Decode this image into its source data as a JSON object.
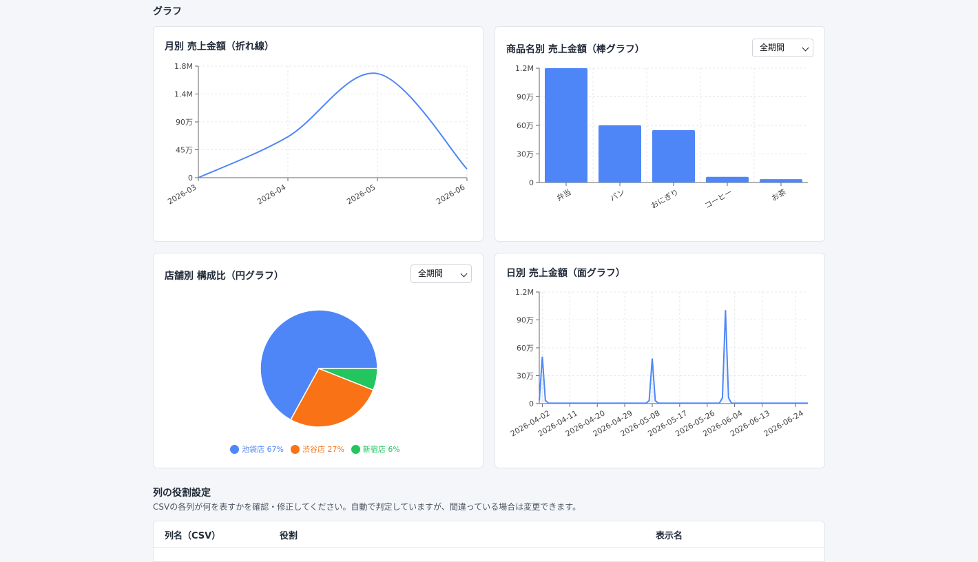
{
  "section_title": "グラフ",
  "charts": {
    "monthly": {
      "title": "月別 売上金額（折れ線）"
    },
    "product": {
      "title": "商品名別 売上金額（棒グラフ）",
      "period_select": "全期間"
    },
    "store": {
      "title": "店舗別 構成比（円グラフ）",
      "period_select": "全期間"
    },
    "daily": {
      "title": "日別 売上金額（面グラフ）"
    }
  },
  "chart_data": [
    {
      "type": "line",
      "title": "月別 売上金額（折れ線）",
      "x": [
        "2026-03",
        "2026-04",
        "2026-05",
        "2026-06"
      ],
      "y": [
        0,
        660000,
        1680000,
        140000
      ],
      "yticks": [
        "0",
        "45万",
        "90万",
        "1.4M",
        "1.8M"
      ],
      "ylim": [
        0,
        1800000
      ],
      "grid": true,
      "color": "#4f86f7"
    },
    {
      "type": "bar",
      "title": "商品名別 売上金額（棒グラフ）",
      "categories": [
        "弁当",
        "パン",
        "おにぎり",
        "コーヒー",
        "お茶"
      ],
      "values": [
        1200000,
        600000,
        550000,
        60000,
        35000
      ],
      "yticks": [
        "0",
        "30万",
        "60万",
        "90万",
        "1.2M"
      ],
      "ylim": [
        0,
        1200000
      ],
      "grid": true,
      "color": "#4f86f7"
    },
    {
      "type": "pie",
      "title": "店舗別 構成比（円グラフ）",
      "series": [
        {
          "name": "池袋店",
          "value": 67,
          "label": "池袋店 67%",
          "color": "#4f86f7"
        },
        {
          "name": "渋谷店",
          "value": 27,
          "label": "渋谷店 27%",
          "color": "#f97316"
        },
        {
          "name": "新宿店",
          "value": 6,
          "label": "新宿店 6%",
          "color": "#22c55e"
        }
      ],
      "legend": "bottom"
    },
    {
      "type": "area",
      "title": "日別 売上金額（面グラフ）",
      "xticks": [
        "2026-04-02",
        "2026-04-11",
        "2026-04-20",
        "2026-04-29",
        "2026-05-08",
        "2026-05-17",
        "2026-05-26",
        "2026-06-04",
        "2026-06-13",
        "2026-06-24"
      ],
      "peaks": [
        {
          "date": "2026-04-02",
          "value": 500000
        },
        {
          "date": "2026-05-08",
          "value": 480000
        },
        {
          "date": "2026-06-01",
          "value": 1000000
        }
      ],
      "baseline": 5000,
      "yticks": [
        "0",
        "30万",
        "60万",
        "90万",
        "1.2M"
      ],
      "ylim": [
        0,
        1200000
      ],
      "grid": true,
      "color": "#4f86f7"
    }
  ],
  "role_settings": {
    "title": "列の役割設定",
    "description": "CSVの各列が何を表すかを確認・修正してください。自動で判定していますが、間違っている場合は変更できます。",
    "columns": [
      "列名（CSV）",
      "役割",
      "表示名"
    ]
  }
}
